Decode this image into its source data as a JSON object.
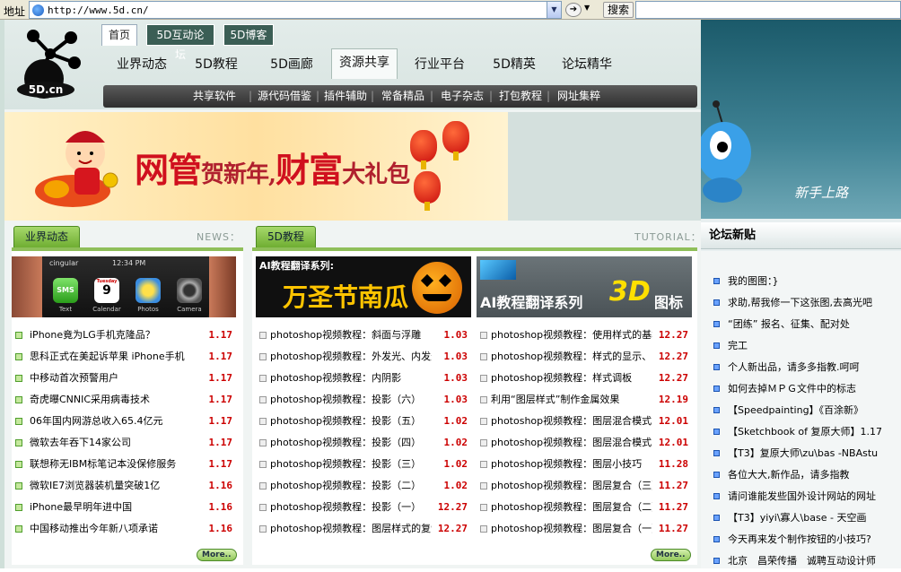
{
  "browser": {
    "address_label": "地址",
    "url": "http://www.5d.cn/",
    "search_label": "搜索"
  },
  "logo_text": "5D.cn",
  "top_tabs": [
    "首页",
    "5D互动论坛",
    "5D博客"
  ],
  "main_nav": [
    "业界动态",
    "5D教程",
    "5D画廊",
    "资源共享",
    "行业平台",
    "5D精英",
    "论坛精华"
  ],
  "sub_nav": [
    "共享软件",
    "源代码借鉴",
    "插件辅助",
    "常备精品",
    "电子杂志",
    "打包教程",
    "网址集粹"
  ],
  "banner": {
    "text_a": "网管",
    "text_b": "贺新年,",
    "text_c": "财富",
    "text_d": "大礼包"
  },
  "news": {
    "title": "业界动态",
    "tag": "NEWS：",
    "thumb": {
      "carrier": "cingular",
      "time": "12:34 PM",
      "apps": [
        "SMS",
        "9",
        "",
        ""
      ],
      "app_labels": [
        "Text",
        "Calendar",
        "Photos",
        "Camera"
      ],
      "calendar_day": "Tuesday"
    },
    "items": [
      {
        "t": "iPhone竟为LG手机克隆品？",
        "d": "1.17"
      },
      {
        "t": "思科正式在美起诉苹果 iPhone手机",
        "d": "1.17"
      },
      {
        "t": "中移动首次预警用户",
        "d": "1.17"
      },
      {
        "t": "奇虎曝CNNIC采用病毒技术",
        "d": "1.17"
      },
      {
        "t": "06年国内网游总收入65.4亿元",
        "d": "1.17"
      },
      {
        "t": "微软去年吞下14家公司",
        "d": "1.17"
      },
      {
        "t": "联想称无IBM标笔记本没保修服务",
        "d": "1.17"
      },
      {
        "t": "微软IE7浏览器装机量突破1亿",
        "d": "1.16"
      },
      {
        "t": "iPhone最早明年进中国",
        "d": "1.16"
      },
      {
        "t": "中国移动推出今年新八项承诺",
        "d": "1.16"
      }
    ],
    "more": "More.."
  },
  "tutorial": {
    "title": "5D教程",
    "tag": "TUTORIAL：",
    "img1_top": "AI教程翻译系列:",
    "img1_main": "万圣节南瓜",
    "img2_main": "AI教程翻译系列",
    "img2_3d": "3D",
    "img2_end": "图标",
    "col1": [
      {
        "t": "photoshop视频教程：斜面与浮雕",
        "d": "1.03"
      },
      {
        "t": "photoshop视频教程：外发光、内发光",
        "d": "1.03"
      },
      {
        "t": "photoshop视频教程：内阴影",
        "d": "1.03"
      },
      {
        "t": "photoshop视频教程：投影（六）",
        "d": "1.03"
      },
      {
        "t": "photoshop视频教程：投影（五）",
        "d": "1.02"
      },
      {
        "t": "photoshop视频教程：投影（四）",
        "d": "1.02"
      },
      {
        "t": "photoshop视频教程：投影（三）",
        "d": "1.02"
      },
      {
        "t": "photoshop视频教程：投影（二）",
        "d": "1.02"
      },
      {
        "t": "photoshop视频教程：投影（一）",
        "d": "12.27"
      },
      {
        "t": "photoshop视频教程：图层样式的复制",
        "d": "12.27"
      }
    ],
    "col2": [
      {
        "t": "photoshop视频教程：使用样式的基本方法",
        "d": "12.27"
      },
      {
        "t": "photoshop视频教程：样式的显示、隐藏",
        "d": "12.27"
      },
      {
        "t": "photoshop视频教程：样式调板",
        "d": "12.27"
      },
      {
        "t": "利用“图层样式”制作金属效果",
        "d": "12.19"
      },
      {
        "t": "photoshop视频教程：图层混合模式",
        "d": "12.01"
      },
      {
        "t": "photoshop视频教程：图层混合模式",
        "d": "12.01"
      },
      {
        "t": "photoshop视频教程：图层小技巧",
        "d": "11.28"
      },
      {
        "t": "photoshop视频教程：图层复合（三）",
        "d": "11.27"
      },
      {
        "t": "photoshop视频教程：图层复合（二）",
        "d": "11.27"
      },
      {
        "t": "photoshop视频教程：图层复合（一）",
        "d": "11.27"
      }
    ],
    "more": "More.."
  },
  "right": {
    "art_text": "新手上路",
    "forum_title": "论坛新贴",
    "items": [
      "我的图图：}",
      "求助,帮我修一下这张图,去高光吧",
      "“团练” 报名、征集、配对处",
      "完工",
      "个人新出品，请多多指教.呵呵",
      "如何去掉ＭＰＧ文件中的标志",
      "【Speedpainting】《百涂新》",
      "【Sketchbook of 复原大师】1.17",
      "【T3】复原大师\\zu\\bas -NBAstu",
      "各位大大,新作品，请多指教",
      "请问谁能发些国外设计网站的网址",
      "【T3】yiyi\\寡人\\base - 天空画",
      "今天再来发个制作按钮的小技巧?",
      "北京　昌荣传播　诚聘互动设计师"
    ]
  }
}
